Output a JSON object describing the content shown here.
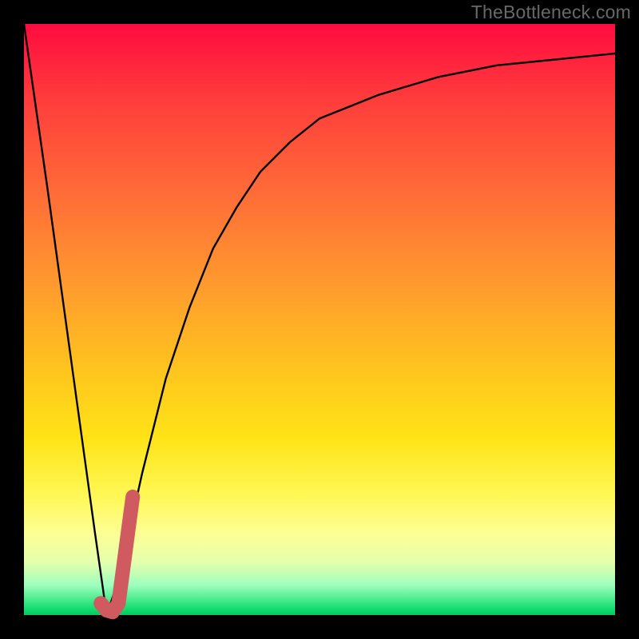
{
  "branding": {
    "text": "TheBottleneck.com"
  },
  "chart_data": {
    "type": "line",
    "title": "",
    "xlabel": "",
    "ylabel": "",
    "xlim": [
      0,
      1
    ],
    "ylim": [
      0,
      100
    ],
    "series": [
      {
        "name": "curve",
        "x": [
          0.0,
          0.04,
          0.08,
          0.12,
          0.14,
          0.16,
          0.2,
          0.24,
          0.28,
          0.32,
          0.36,
          0.4,
          0.45,
          0.5,
          0.55,
          0.6,
          0.7,
          0.8,
          0.9,
          1.0
        ],
        "values": [
          100,
          72,
          43,
          14,
          0,
          6,
          24,
          40,
          52,
          62,
          69,
          75,
          80,
          84,
          86,
          88,
          91,
          93,
          94,
          95
        ]
      },
      {
        "name": "pink-marker",
        "x": [
          0.13,
          0.14,
          0.15,
          0.16,
          0.168,
          0.176,
          0.184
        ],
        "values": [
          2.0,
          0.8,
          0.5,
          2.0,
          8.0,
          14.0,
          20.0
        ]
      }
    ],
    "colors": {
      "curve": "#000000",
      "marker": "#cf5b60",
      "gradient_top": "#ff0b3f",
      "gradient_bottom": "#08c85e"
    }
  }
}
